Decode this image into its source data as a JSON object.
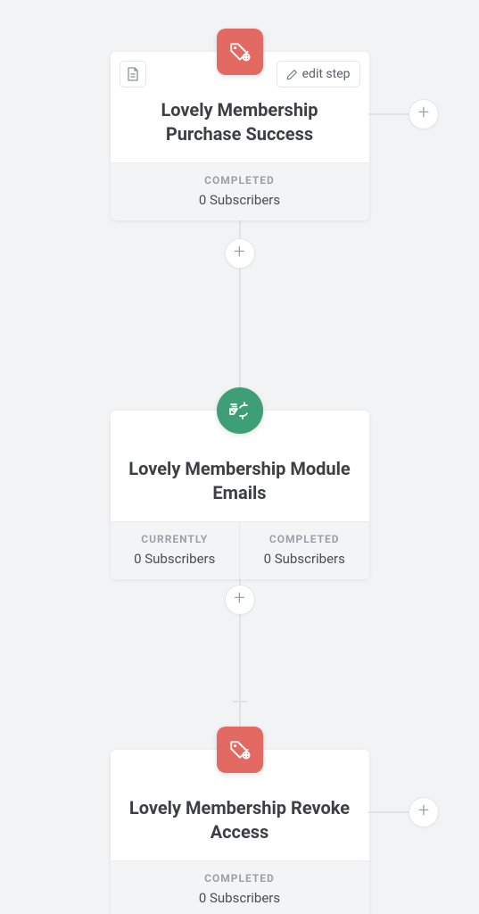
{
  "actions": {
    "edit_step_label": "edit step",
    "plus_glyph": "+"
  },
  "cards": [
    {
      "title": "Lovely Membership Purchase Success",
      "badge_color": "red",
      "badge_icon": "tag-add",
      "has_side_plus": true,
      "has_doc_button": true,
      "has_edit_button": true,
      "stats": [
        {
          "label": "COMPLETED",
          "value": "0 Subscribers"
        }
      ]
    },
    {
      "title": "Lovely Membership Module Emails",
      "badge_color": "green",
      "badge_icon": "email-cycle",
      "has_side_plus": false,
      "has_doc_button": false,
      "has_edit_button": false,
      "stats": [
        {
          "label": "CURRENTLY",
          "value": "0 Subscribers"
        },
        {
          "label": "COMPLETED",
          "value": "0 Subscribers"
        }
      ]
    },
    {
      "title": "Lovely Membership Revoke Access",
      "badge_color": "red",
      "badge_icon": "tag-add",
      "has_side_plus": true,
      "has_doc_button": false,
      "has_edit_button": false,
      "stats": [
        {
          "label": "COMPLETED",
          "value": "0 Subscribers"
        }
      ]
    }
  ]
}
